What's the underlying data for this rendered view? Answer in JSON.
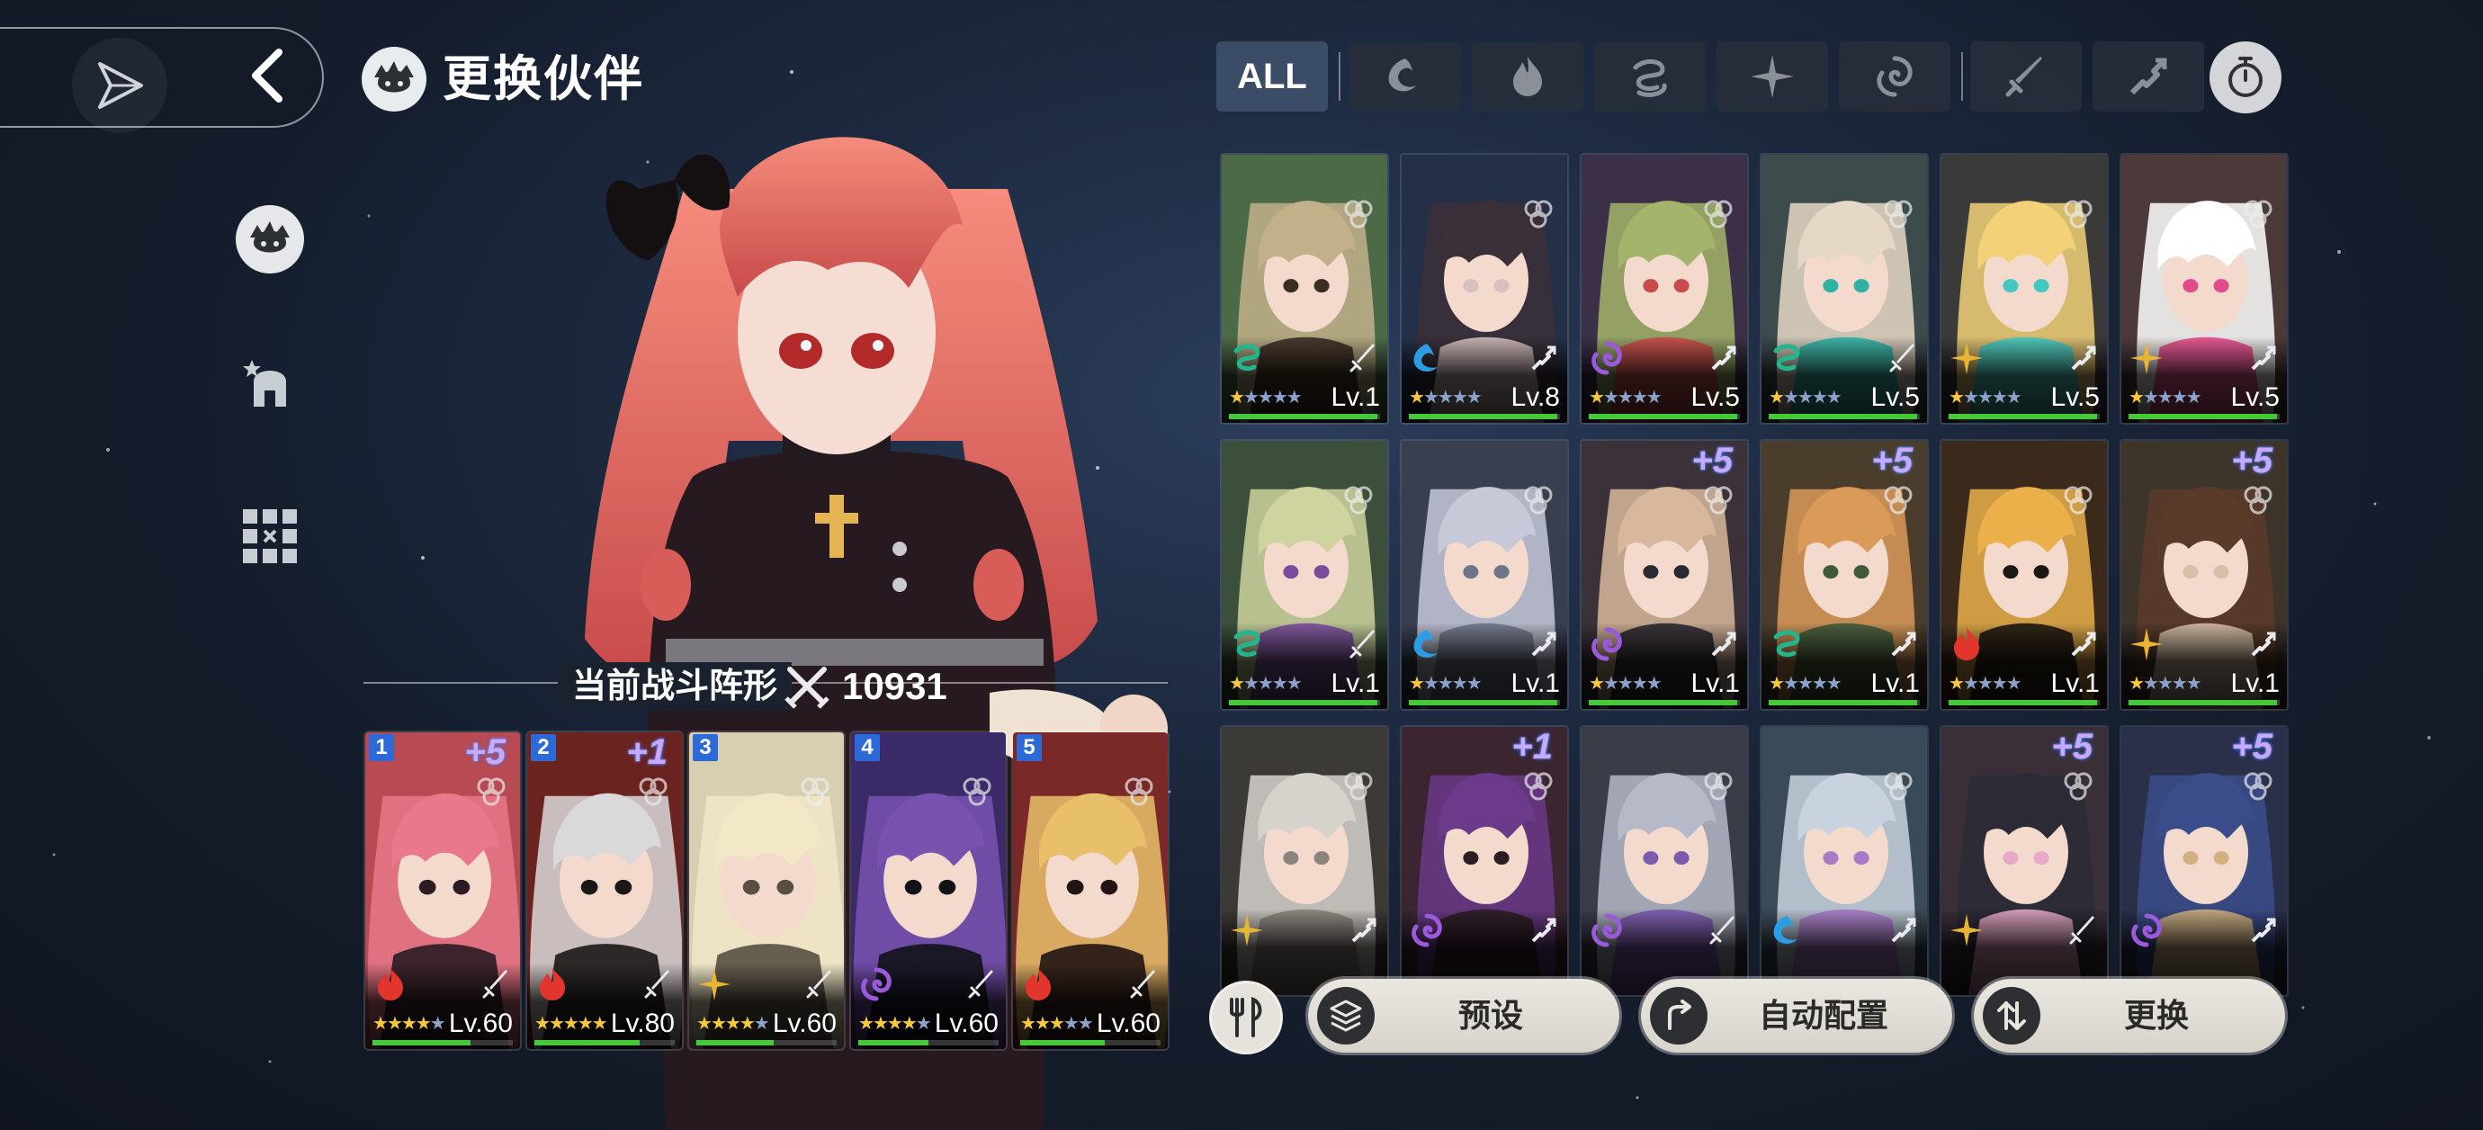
{
  "header": {
    "title": "更换伙伴",
    "back_label": "back"
  },
  "sidebar": {
    "items": [
      {
        "name": "partner-tab",
        "icon": "chibi-head-icon",
        "active": true
      },
      {
        "name": "equipment-tab",
        "icon": "helmet-star-icon",
        "active": false
      },
      {
        "name": "formation-grid-tab",
        "icon": "grid-icon",
        "active": false
      }
    ]
  },
  "formation": {
    "label": "当前战斗阵形",
    "power": "10931"
  },
  "team": [
    {
      "slot": "1",
      "bonus": "+5",
      "level": "Lv.60",
      "stars": 4,
      "element": "fire",
      "class": "sword",
      "hp": 0.7,
      "palette": [
        "#b74a52",
        "#e8788a",
        "#2a1c22"
      ]
    },
    {
      "slot": "2",
      "bonus": "+1",
      "level": "Lv.80",
      "stars": 5,
      "element": "fire",
      "class": "sword",
      "hp": 0.75,
      "palette": [
        "#6b2320",
        "#d9d9d9",
        "#1b1717"
      ]
    },
    {
      "slot": "3",
      "bonus": "",
      "level": "Lv.60",
      "stars": 4,
      "element": "light",
      "class": "sword",
      "hp": 0.55,
      "palette": [
        "#d8cfb2",
        "#f2e8c8",
        "#575042"
      ]
    },
    {
      "slot": "4",
      "bonus": "",
      "level": "Lv.60",
      "stars": 4,
      "element": "dark",
      "class": "sword",
      "hp": 0.5,
      "palette": [
        "#3a2a68",
        "#7952b0",
        "#111318"
      ]
    },
    {
      "slot": "5",
      "bonus": "",
      "level": "Lv.60",
      "stars": 3,
      "element": "fire",
      "class": "sword",
      "hp": 0.6,
      "palette": [
        "#7a2828",
        "#e8c06b",
        "#221414"
      ]
    }
  ],
  "filters": {
    "all_label": "ALL",
    "items": [
      "water-icon",
      "fire-icon",
      "wind-icon",
      "light-icon",
      "dark-icon",
      "sword-class-icon",
      "ranged-class-icon"
    ],
    "timer_icon": "stopwatch-icon"
  },
  "roster": [
    {
      "bonus": "",
      "level": "Lv.1",
      "stars": 1,
      "element": "wind",
      "class": "sword",
      "palette": [
        "#4d6a48",
        "#c2b08b",
        "#3c2d24"
      ]
    },
    {
      "bonus": "",
      "level": "Lv.8",
      "stars": 1,
      "element": "water",
      "class": "ranged",
      "palette": [
        "#243048",
        "#3b2f38",
        "#d6c0c0"
      ]
    },
    {
      "bonus": "",
      "level": "Lv.5",
      "stars": 1,
      "element": "dark",
      "class": "ranged",
      "palette": [
        "#3b3047",
        "#a4b46a",
        "#c94a4a"
      ]
    },
    {
      "bonus": "",
      "level": "Lv.5",
      "stars": 1,
      "element": "wind",
      "class": "sword",
      "palette": [
        "#3c4b4b",
        "#e6d8c6",
        "#2fb2a4"
      ]
    },
    {
      "bonus": "",
      "level": "Lv.5",
      "stars": 1,
      "element": "light",
      "class": "ranged",
      "palette": [
        "#3a3a3a",
        "#f2d178",
        "#44c8c2"
      ]
    },
    {
      "bonus": "",
      "level": "Lv.5",
      "stars": 1,
      "element": "light",
      "class": "ranged",
      "palette": [
        "#4c3a3a",
        "#ffffff",
        "#e24a8a"
      ]
    },
    {
      "bonus": "",
      "level": "Lv.1",
      "stars": 1,
      "element": "wind",
      "class": "sword",
      "palette": [
        "#3b4f3b",
        "#cfd3a0",
        "#7a4b9c"
      ]
    },
    {
      "bonus": "",
      "level": "Lv.1",
      "stars": 1,
      "element": "water",
      "class": "ranged",
      "palette": [
        "#3a3f4f",
        "#c7c9d8",
        "#6e7488"
      ]
    },
    {
      "bonus": "+5",
      "level": "Lv.1",
      "stars": 1,
      "element": "dark",
      "class": "ranged",
      "palette": [
        "#3a3238",
        "#d8b89c",
        "#2a2830"
      ]
    },
    {
      "bonus": "+5",
      "level": "Lv.1",
      "stars": 1,
      "element": "wind",
      "class": "ranged",
      "palette": [
        "#4a3d2c",
        "#d99a5a",
        "#3f5a3b"
      ]
    },
    {
      "bonus": "",
      "level": "Lv.1",
      "stars": 1,
      "element": "fire",
      "class": "ranged",
      "palette": [
        "#3b2a1b",
        "#ebb04a",
        "#1c1814"
      ]
    },
    {
      "bonus": "+5",
      "level": "Lv.1",
      "stars": 1,
      "element": "light",
      "class": "ranged",
      "palette": [
        "#3d342a",
        "#5a3b2a",
        "#d8c0a8"
      ]
    },
    {
      "bonus": "",
      "level": "",
      "stars": 0,
      "element": "light",
      "class": "ranged",
      "palette": [
        "#3c3a36",
        "#d6d2cc",
        "#8a847c"
      ]
    },
    {
      "bonus": "+1",
      "level": "",
      "stars": 0,
      "element": "dark",
      "class": "ranged",
      "palette": [
        "#3a2530",
        "#6b3a8a",
        "#2a1e22"
      ]
    },
    {
      "bonus": "",
      "level": "",
      "stars": 0,
      "element": "dark",
      "class": "sword",
      "palette": [
        "#3a3c48",
        "#b5b9c8",
        "#7b5ab0"
      ]
    },
    {
      "bonus": "",
      "level": "",
      "stars": 0,
      "element": "water",
      "class": "ranged",
      "palette": [
        "#3b4a58",
        "#c8d3df",
        "#a97ac8"
      ]
    },
    {
      "bonus": "+5",
      "level": "",
      "stars": 0,
      "element": "light",
      "class": "sword",
      "palette": [
        "#3a2f36",
        "#2b2a35",
        "#e8a8c8"
      ]
    },
    {
      "bonus": "+5",
      "level": "",
      "stars": 0,
      "element": "dark",
      "class": "ranged",
      "palette": [
        "#2a2f4a",
        "#3a4d8a",
        "#d2b080"
      ]
    }
  ],
  "actions": {
    "meal_icon": "fork-knife-icon",
    "preset_label": "预设",
    "auto_label": "自动配置",
    "swap_label": "更换"
  }
}
